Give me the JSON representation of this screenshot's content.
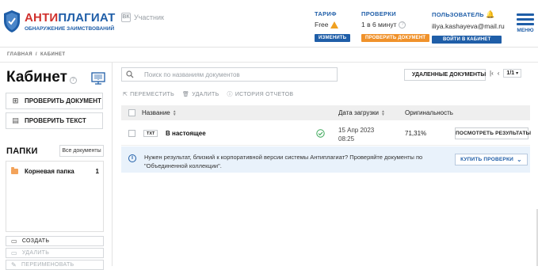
{
  "brand": {
    "name_part1": "АНТИ",
    "name_part2": "ПЛАГИАТ",
    "tagline": "ОБНАРУЖЕНИЕ ЗАИМСТВОВАНИЙ"
  },
  "participant": {
    "label": "Участник"
  },
  "tariff": {
    "title": "ТАРИФ",
    "value": "Free",
    "button": "ИЗМЕНИТЬ"
  },
  "checks": {
    "title": "ПРОВЕРКИ",
    "value": "1 в 6 минут",
    "button": "ПРОВЕРИТЬ ДОКУМЕНТ"
  },
  "user": {
    "title": "ПОЛЬЗОВАТЕЛЬ",
    "email": "iliya.kashayeva@mail.ru",
    "button": "ВОЙТИ В КАБИНЕТ"
  },
  "menu": {
    "label": "МЕНЮ"
  },
  "breadcrumb": {
    "home": "ГЛАВНАЯ",
    "sep": "/",
    "current": "КАБИНЕТ"
  },
  "sidebar": {
    "title": "Кабинет",
    "check_document": "ПРОВЕРИТЬ ДОКУМЕНТ",
    "check_text": "ПРОВЕРИТЬ ТЕКСТ",
    "folders_title": "ПАПКИ",
    "all_docs": "Все документы",
    "folders": [
      {
        "name": "Корневая папка",
        "count": "1"
      }
    ],
    "create": "СОЗДАТЬ",
    "delete": "УДАЛИТЬ",
    "rename": "ПЕРЕИМЕНОВАТЬ"
  },
  "search": {
    "placeholder": "Поиск по названиям документов"
  },
  "deleted_docs": "УДАЛЕННЫЕ ДОКУМЕНТЫ",
  "pager": {
    "page": "1/1"
  },
  "actions": {
    "move": "ПЕРЕМЕСТИТЬ",
    "delete": "УДАЛИТЬ",
    "history": "ИСТОРИЯ ОТЧЕТОВ"
  },
  "table": {
    "headers": {
      "name": "Название",
      "date": "Дата загрузки",
      "originality": "Оригинальность"
    },
    "rows": [
      {
        "type": "TXT",
        "name": "В настоящее",
        "date_line1": "15 Апр 2023",
        "date_line2": "08:25",
        "originality": "71,31%",
        "button": "ПОСМОТРЕТЬ РЕЗУЛЬТАТЫ"
      }
    ]
  },
  "info": {
    "text": "Нужен результат, близкий к корпоративной версии системы Антиплагиат? Проверяйте документы по \"Объединенной коллекции\".",
    "button": "КУПИТЬ ПРОВЕРКИ"
  },
  "colors": {
    "brand_blue": "#1f5ea8",
    "brand_red": "#d0312d",
    "orange": "#f0922b",
    "success": "#3aa757"
  }
}
